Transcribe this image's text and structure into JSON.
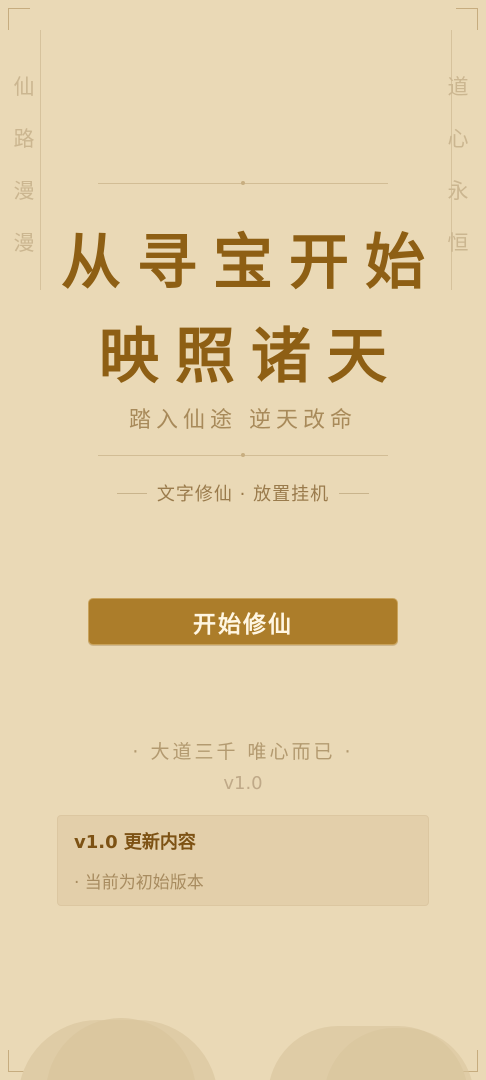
{
  "side": {
    "left_chars": [
      "仙",
      "路",
      "漫",
      "漫"
    ],
    "right_chars": [
      "道",
      "心",
      "永",
      "恒"
    ]
  },
  "hero": {
    "title_line1": "从寻宝开始",
    "title_line2": "映照诸天",
    "subtitle": "踏入仙途  逆天改命",
    "tagline": "文字修仙 · 放置挂机"
  },
  "actions": {
    "start_label": "开始修仙"
  },
  "footer": {
    "motto": "· 大道三千  唯心而已 ·",
    "version": "v1.0"
  },
  "update": {
    "title": "v1.0 更新内容",
    "items": [
      "· 当前为初始版本"
    ]
  },
  "colors": {
    "background": "#ead9b6",
    "title": "#8e5f14",
    "button": "#ac7d2a",
    "button_text": "#fff6e2"
  }
}
